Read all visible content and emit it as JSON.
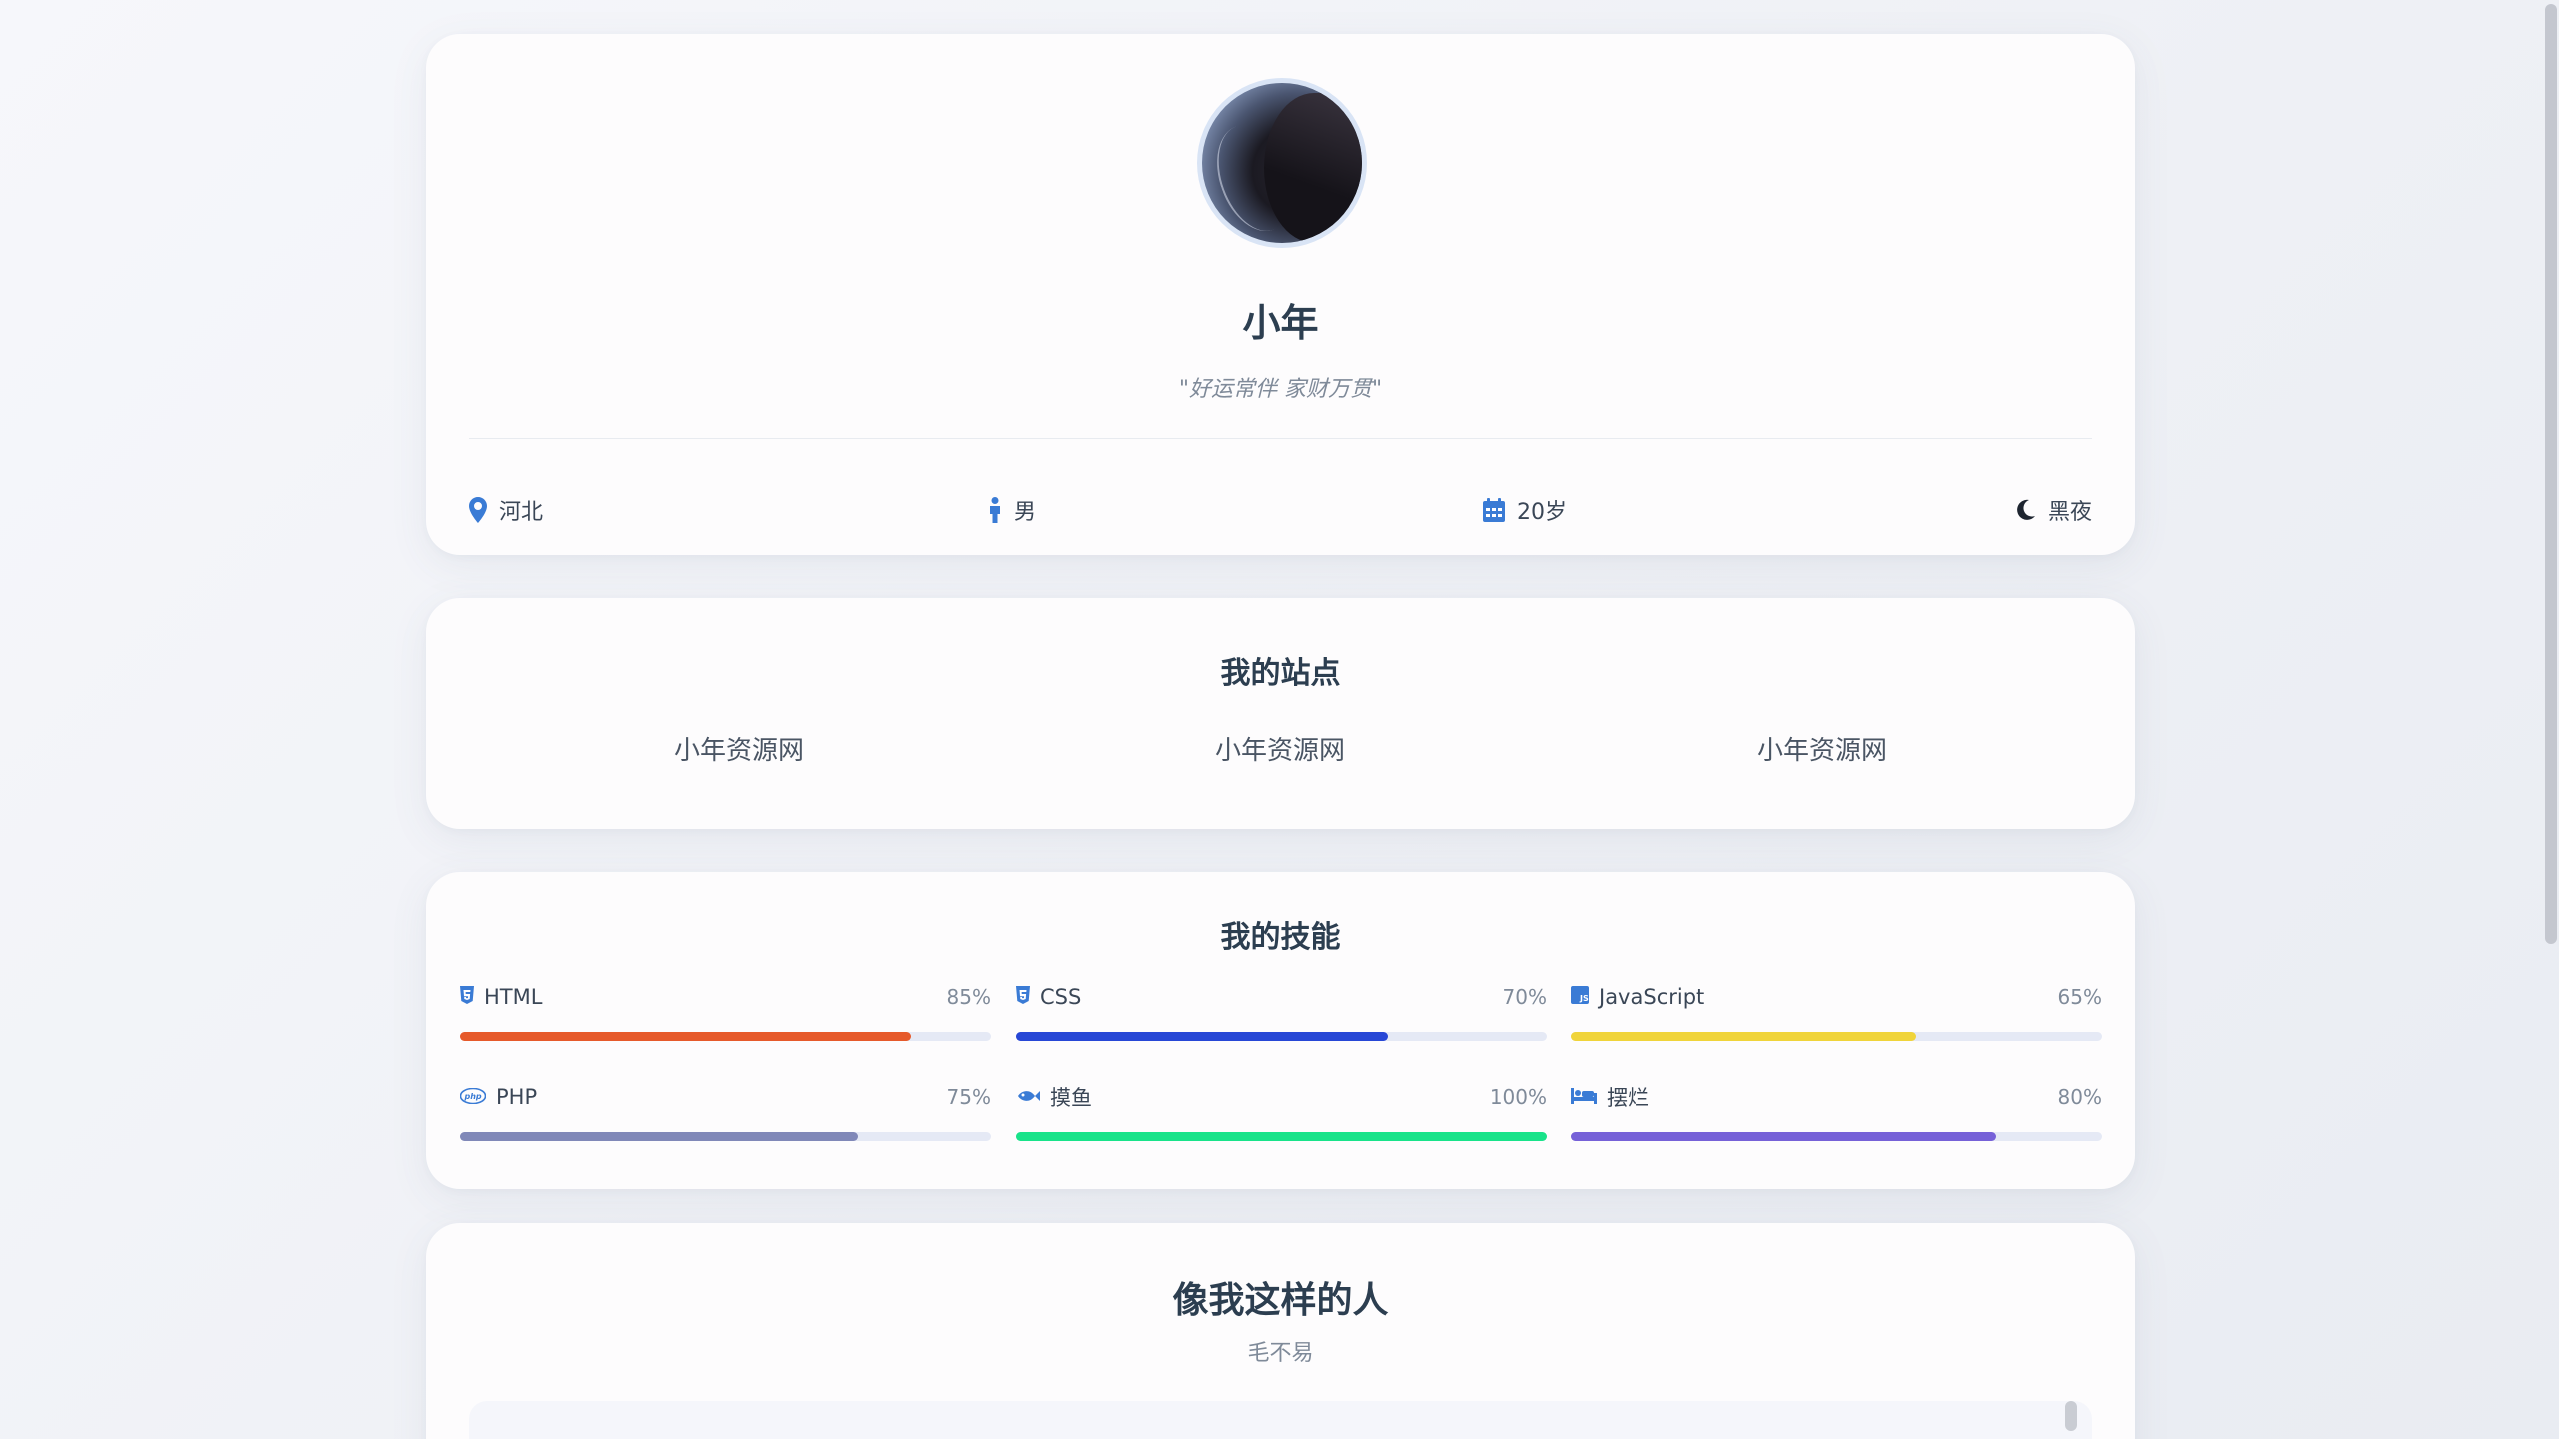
{
  "profile": {
    "name": "小年",
    "motto": "\"好运常伴 家财万贯\"",
    "info": {
      "location": "河北",
      "gender": "男",
      "age": "20岁",
      "theme_toggle": "黑夜"
    }
  },
  "sites": {
    "title": "我的站点",
    "items": [
      "小年资源网",
      "小年资源网",
      "小年资源网"
    ]
  },
  "skills": {
    "title": "我的技能",
    "items": [
      {
        "name": "HTML",
        "percent_label": "85%",
        "value": 85,
        "icon": "html5-icon",
        "color": "#e65a2b"
      },
      {
        "name": "CSS",
        "percent_label": "70%",
        "value": 70,
        "icon": "css3-icon",
        "color": "#2747d6"
      },
      {
        "name": "JavaScript",
        "percent_label": "65%",
        "value": 65,
        "icon": "js-icon",
        "color": "#f0d43a"
      },
      {
        "name": "PHP",
        "percent_label": "75%",
        "value": 75,
        "icon": "php-icon",
        "color": "#8088b8"
      },
      {
        "name": "摸鱼",
        "percent_label": "100%",
        "value": 100,
        "icon": "fish-icon",
        "color": "#19e38a"
      },
      {
        "name": "摆烂",
        "percent_label": "80%",
        "value": 80,
        "icon": "bed-icon",
        "color": "#7661d8"
      }
    ]
  },
  "people": {
    "title": "像我这样的人",
    "subtitle": "毛不易"
  },
  "colors": {
    "accent": "#3a7bd5",
    "text": "#2c3e50",
    "muted": "#7f8a99"
  }
}
